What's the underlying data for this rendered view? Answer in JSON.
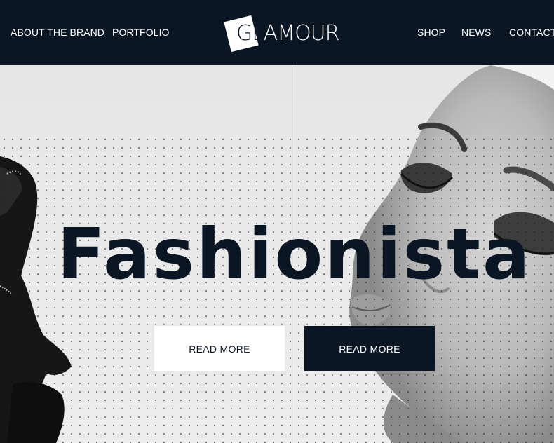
{
  "header": {
    "nav_left": [
      "ABOUT THE BRAND",
      "PORTFOLIO"
    ],
    "nav_right": [
      "SHOP",
      "NEWS",
      "CONTACT"
    ],
    "logo": {
      "on_square": "GL",
      "rest": "AMOUR"
    }
  },
  "hero": {
    "title": "Fashionista",
    "buttons": [
      {
        "label": "READ MORE",
        "style": "light"
      },
      {
        "label": "READ MORE",
        "style": "dark"
      }
    ]
  },
  "colors": {
    "navy": "#0b1624",
    "white": "#ffffff",
    "background": "#e9e9e9"
  }
}
